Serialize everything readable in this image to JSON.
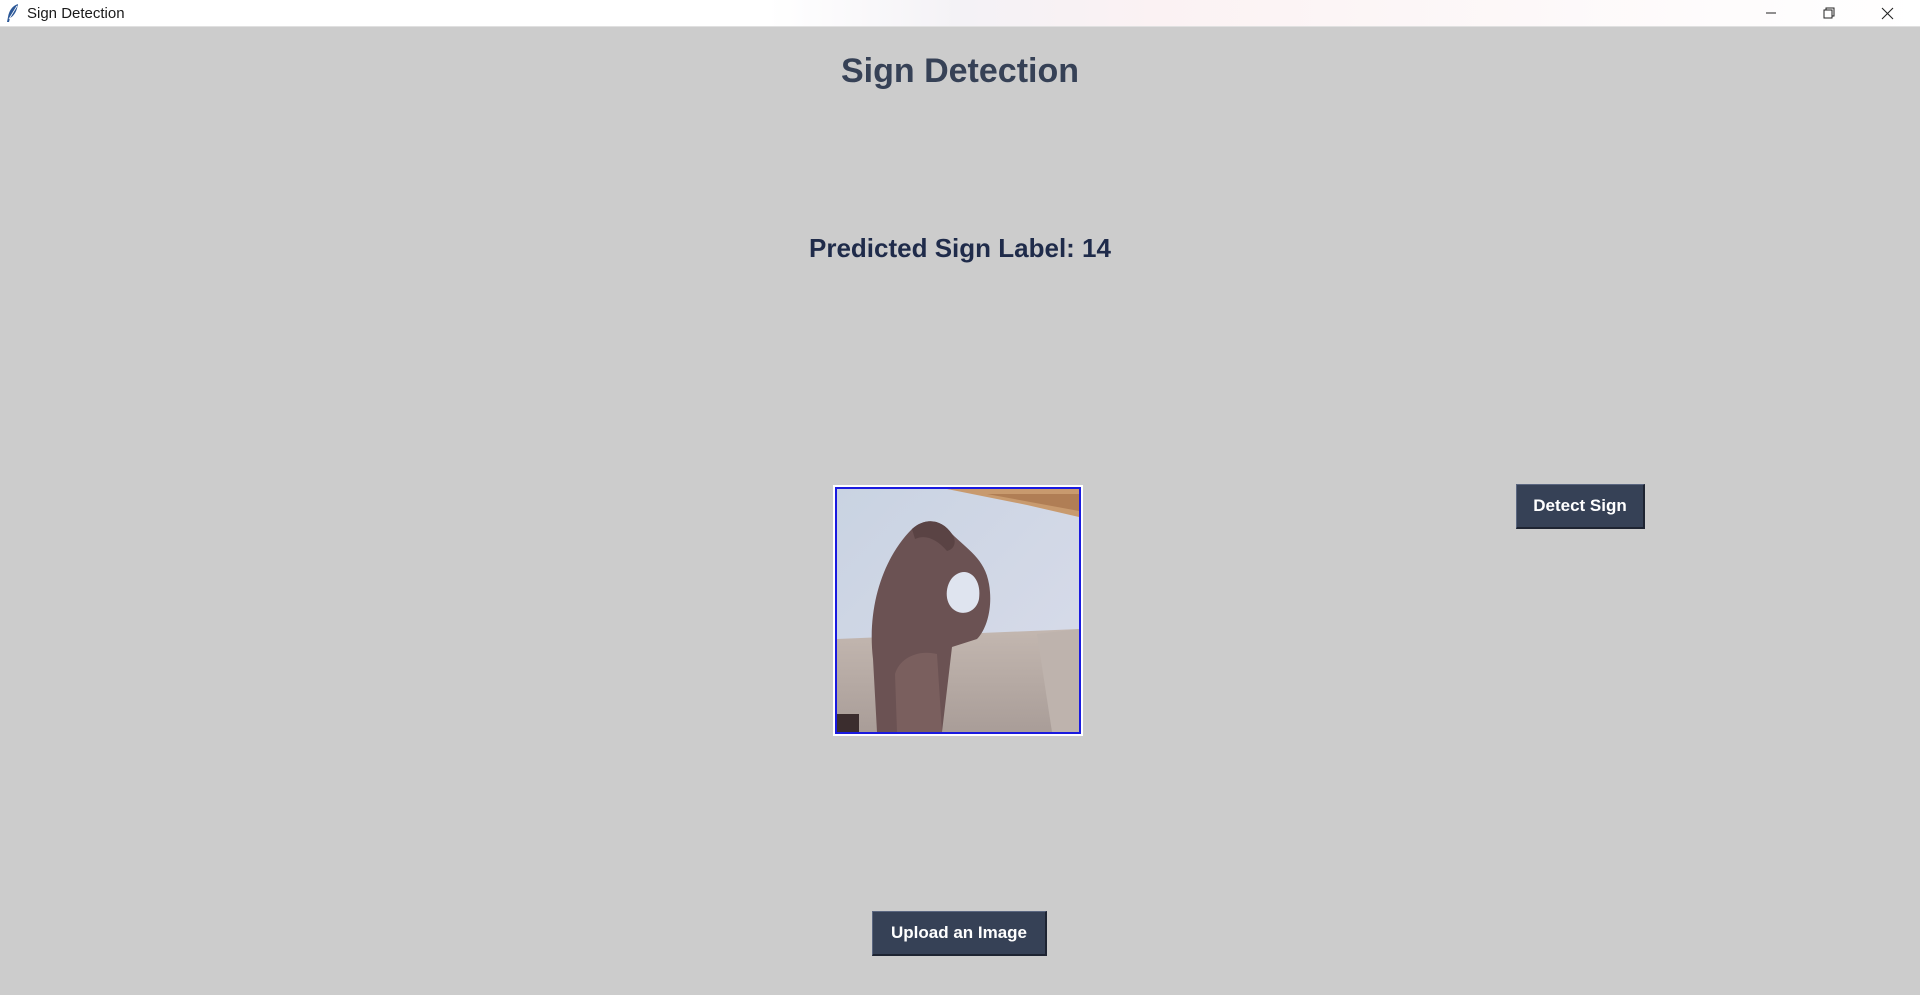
{
  "window": {
    "title": "Sign Detection",
    "controls": {
      "minimize": "minimize-icon",
      "maximize": "restore-icon",
      "close": "close-icon"
    }
  },
  "main": {
    "heading": "Sign Detection",
    "prediction_text": "Predicted Sign Label: 14",
    "preview_image": "hand-sign-photo"
  },
  "buttons": {
    "detect_label": "Detect Sign",
    "upload_label": "Upload an Image"
  },
  "colors": {
    "background": "#cccccc",
    "accent": "#364156",
    "button_text": "#ffffff",
    "image_border": "#1a1adf"
  }
}
